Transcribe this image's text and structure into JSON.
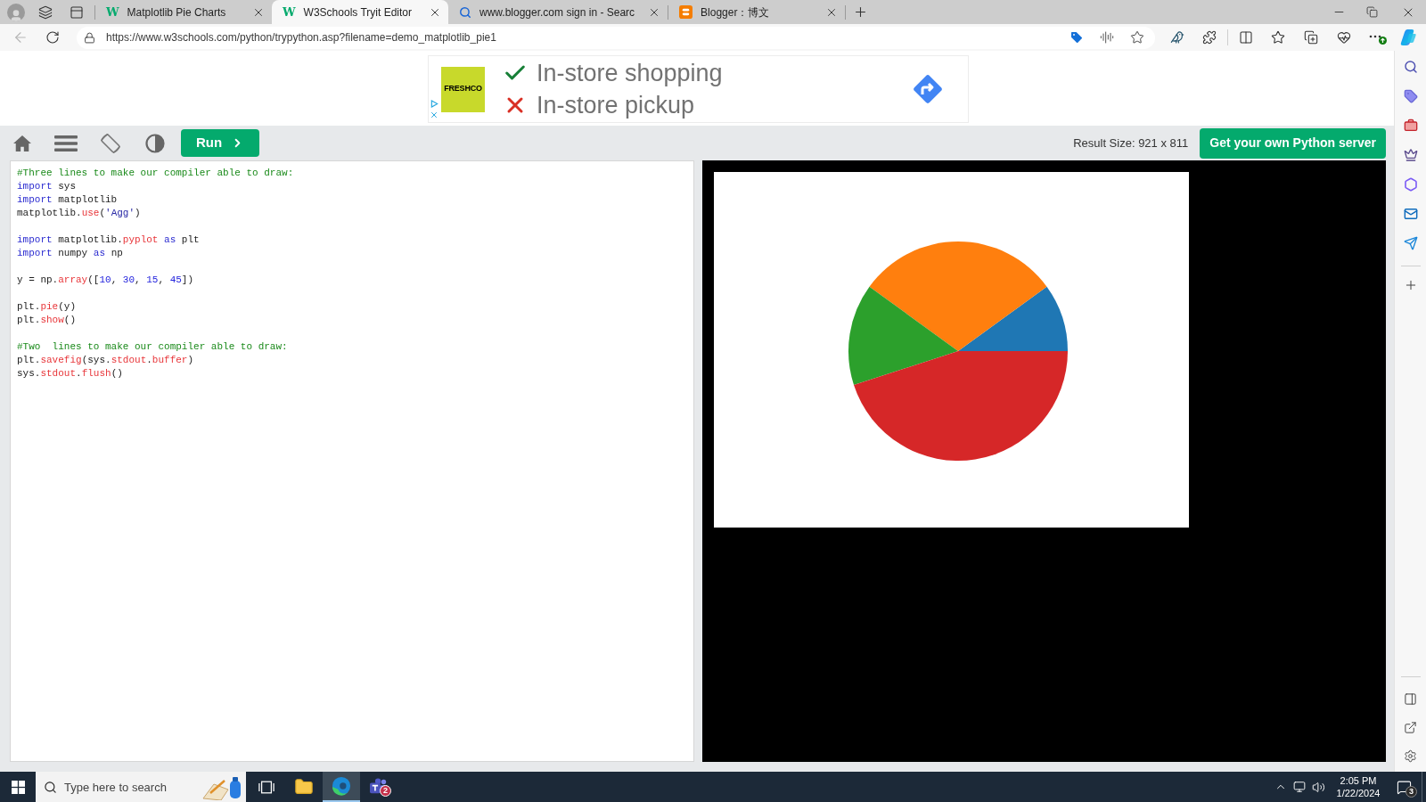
{
  "browser": {
    "tabs": [
      {
        "title": "Matplotlib Pie Charts",
        "kind": "site",
        "favicon": "W",
        "selected": false
      },
      {
        "title": "W3Schools Tryit Editor",
        "kind": "site",
        "favicon": "W",
        "selected": true
      },
      {
        "title": "www.blogger.com sign in - Searc",
        "kind": "search",
        "selected": false
      },
      {
        "title": "Blogger：博文",
        "kind": "blog",
        "selected": false
      }
    ],
    "url": "https://www.w3schools.com/python/trypython.asp?filename=demo_matplotlib_pie1"
  },
  "ad": {
    "logo": "FRESHCO",
    "lines": [
      {
        "text": "In-store shopping",
        "kind": "check"
      },
      {
        "text": "In-store pickup",
        "kind": "cross"
      }
    ]
  },
  "toolbar": {
    "run": "Run",
    "result_size": "Result Size: 921 x 811",
    "server_button": "Get your own Python server"
  },
  "editor": {
    "blocks": [
      [
        [
          {
            "text": "#Three lines to make our compiler able to draw:",
            "kind": "comment"
          }
        ],
        [
          {
            "text": "import",
            "kind": "keyword"
          },
          {
            "text": " sys",
            "kind": "plain"
          }
        ],
        [
          {
            "text": "import",
            "kind": "keyword"
          },
          {
            "text": " matplotlib",
            "kind": "plain"
          }
        ],
        [
          {
            "text": "matplotlib.",
            "kind": "plain"
          },
          {
            "text": "use",
            "kind": "attr"
          },
          {
            "text": "(",
            "kind": "plain"
          },
          {
            "text": "'Agg'",
            "kind": "string"
          },
          {
            "text": ")",
            "kind": "plain"
          }
        ]
      ],
      [
        [
          {
            "text": "import",
            "kind": "keyword"
          },
          {
            "text": " matplotlib.",
            "kind": "plain"
          },
          {
            "text": "pyplot",
            "kind": "attr"
          },
          {
            "text": " as",
            "kind": "keyword"
          },
          {
            "text": " plt",
            "kind": "plain"
          }
        ],
        [
          {
            "text": "import",
            "kind": "keyword"
          },
          {
            "text": " numpy",
            "kind": "plain"
          },
          {
            "text": " as",
            "kind": "keyword"
          },
          {
            "text": " np",
            "kind": "plain"
          }
        ]
      ],
      [
        [
          {
            "text": "y = np.",
            "kind": "plain"
          },
          {
            "text": "array",
            "kind": "attr"
          },
          {
            "text": "([",
            "kind": "plain"
          },
          {
            "text": "10",
            "kind": "number"
          },
          {
            "text": ", ",
            "kind": "plain"
          },
          {
            "text": "30",
            "kind": "number"
          },
          {
            "text": ", ",
            "kind": "plain"
          },
          {
            "text": "15",
            "kind": "number"
          },
          {
            "text": ", ",
            "kind": "plain"
          },
          {
            "text": "45",
            "kind": "number"
          },
          {
            "text": "])",
            "kind": "plain"
          }
        ]
      ],
      [
        [
          {
            "text": "plt.",
            "kind": "plain"
          },
          {
            "text": "pie",
            "kind": "attr"
          },
          {
            "text": "(y)",
            "kind": "plain"
          }
        ],
        [
          {
            "text": "plt.",
            "kind": "plain"
          },
          {
            "text": "show",
            "kind": "attr"
          },
          {
            "text": "()",
            "kind": "plain"
          }
        ]
      ],
      [
        [
          {
            "text": "#Two  lines to make our compiler able to draw:",
            "kind": "comment"
          }
        ],
        [
          {
            "text": "plt.",
            "kind": "plain"
          },
          {
            "text": "savefig",
            "kind": "attr"
          },
          {
            "text": "(sys.",
            "kind": "plain"
          },
          {
            "text": "stdout",
            "kind": "attr"
          },
          {
            "text": ".",
            "kind": "plain"
          },
          {
            "text": "buffer",
            "kind": "attr"
          },
          {
            "text": ")",
            "kind": "plain"
          }
        ],
        [
          {
            "text": "sys.",
            "kind": "plain"
          },
          {
            "text": "stdout",
            "kind": "attr"
          },
          {
            "text": ".",
            "kind": "plain"
          },
          {
            "text": "flush",
            "kind": "attr"
          },
          {
            "text": "()",
            "kind": "plain"
          }
        ]
      ]
    ]
  },
  "result": {
    "chart_data": {
      "type": "pie",
      "values": [
        10,
        30,
        15,
        45
      ],
      "colors": [
        "#1f77b4",
        "#ff7f0e",
        "#2ca02c",
        "#d62728"
      ]
    }
  },
  "taskbar": {
    "search": {
      "placeholder": "Type here to search"
    },
    "apps": [
      {
        "kind": "taskview",
        "selected": false
      },
      {
        "kind": "explorer",
        "selected": false
      },
      {
        "kind": "browser",
        "selected": true
      },
      {
        "kind": "teams",
        "selected": false,
        "badge": "2"
      }
    ],
    "time": "2:05 PM",
    "date": "1/22/2024",
    "notifications": "3"
  }
}
